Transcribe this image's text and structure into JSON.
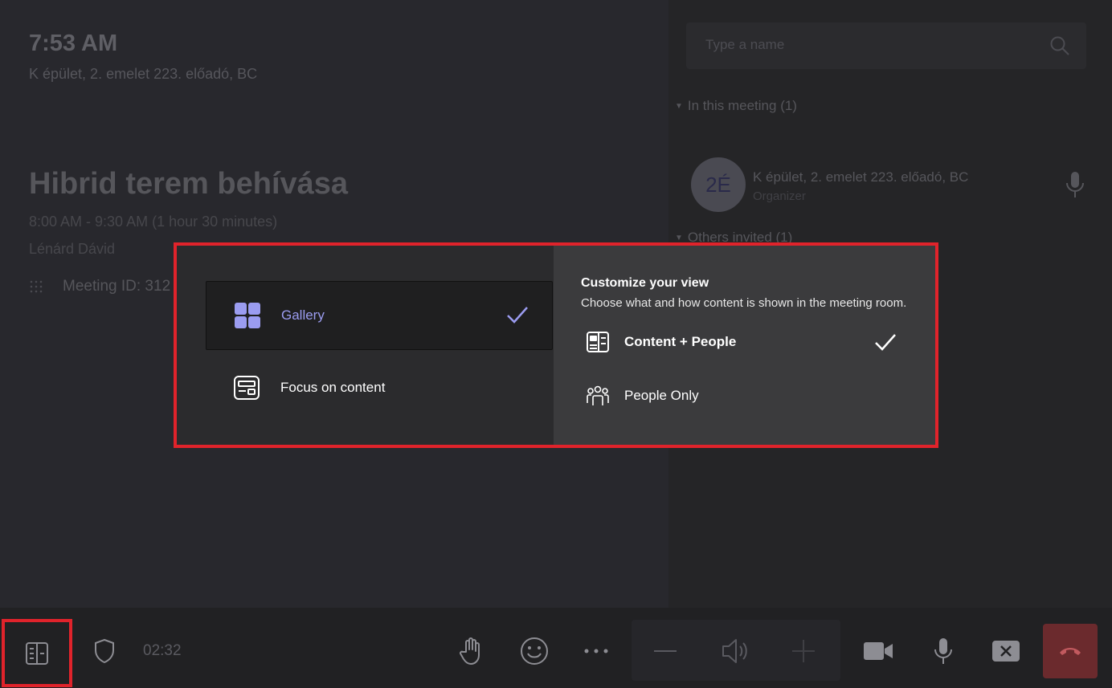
{
  "meeting": {
    "current_time": "7:53 AM",
    "location": "K épület, 2. emelet 223. előadó, BC",
    "title": "Hibrid terem behívása",
    "time_range": "8:00 AM - 9:30 AM (1 hour 30 minutes)",
    "organizer": "Lénárd Dávid",
    "meeting_id": "Meeting ID: 312"
  },
  "roster": {
    "search_placeholder": "Type a name",
    "in_meeting_label": "In this meeting (1)",
    "others_invited_label": "Others invited (1)",
    "participant": {
      "initials": "2É",
      "name": "K épület, 2. emelet 223. előadó, BC",
      "role": "Organizer"
    }
  },
  "popup": {
    "layout_options": [
      {
        "label": "Gallery",
        "selected": true,
        "icon": "gallery-icon"
      },
      {
        "label": "Focus on content",
        "selected": false,
        "icon": "focus-content-icon"
      }
    ],
    "customize_title": "Customize your view",
    "customize_subtitle": "Choose what and how content is shown in the meeting room.",
    "content_options": [
      {
        "label": "Content + People",
        "selected": true,
        "icon": "content-people-icon"
      },
      {
        "label": "People Only",
        "selected": false,
        "icon": "people-only-icon"
      }
    ]
  },
  "toolbar": {
    "timer": "02:32",
    "icons": [
      "layout-view-icon",
      "shield-icon",
      "raise-hand-icon",
      "emoji-icon",
      "more-icon",
      "volume-down-icon",
      "speaker-icon",
      "volume-up-icon",
      "camera-icon",
      "microphone-icon",
      "share-tray-icon",
      "hang-up-icon"
    ]
  },
  "colors": {
    "accent": "#9b9cf0",
    "highlight_border": "#e0232b",
    "hangup": "#6b2a2d"
  }
}
